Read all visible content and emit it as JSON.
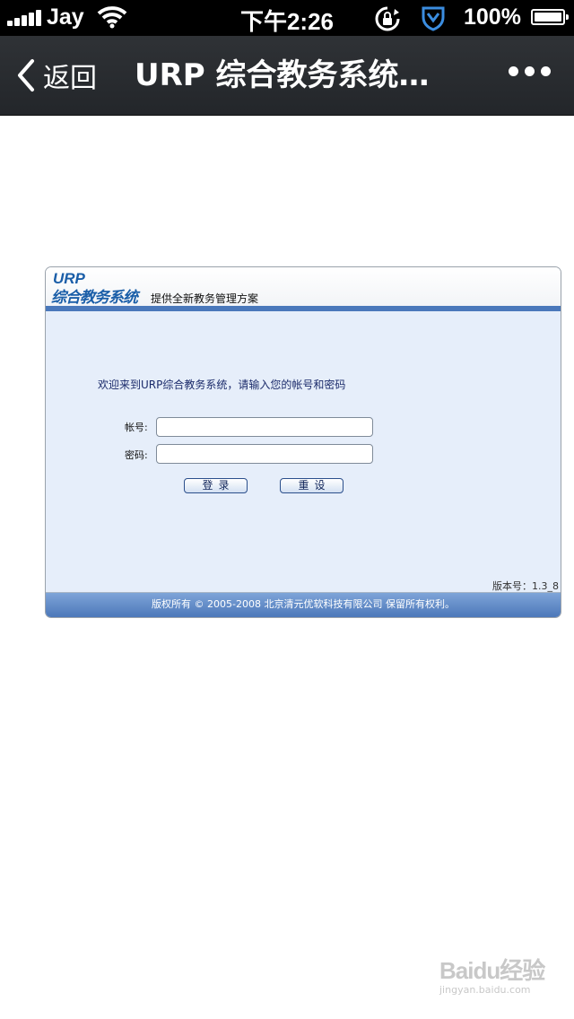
{
  "status_bar": {
    "carrier": "Jay",
    "time": "下午2:26",
    "battery": "100%",
    "icons": [
      "signal-icon",
      "wifi-icon",
      "rotation-lock-icon",
      "vpn-shield-icon",
      "battery-icon"
    ]
  },
  "nav": {
    "back_label": "返回",
    "title": "URP 综合教务系统…",
    "more_icon": "more-dots-icon"
  },
  "login_page": {
    "logo_urp": "URP",
    "logo_name": "综合教务系统",
    "tagline": "提供全新教务管理方案",
    "welcome": "欢迎来到URP综合教务系统，请输入您的帐号和密码",
    "account_label": "帐号:",
    "account_value": "",
    "password_label": "密码:",
    "password_value": "",
    "login_button": "登录",
    "reset_button": "重设",
    "version": "版本号：1.3_8",
    "copyright": "版权所有 © 2005-2008 北京清元优软科技有限公司 保留所有权利。",
    "colors": {
      "header_bar": "#4a78bb",
      "content_bg": "#e6eefa",
      "logo": "#1a5ea8",
      "footer": "#5a86c4"
    }
  },
  "watermark": {
    "logo": "Baidu经验",
    "url": "jingyan.baidu.com"
  }
}
